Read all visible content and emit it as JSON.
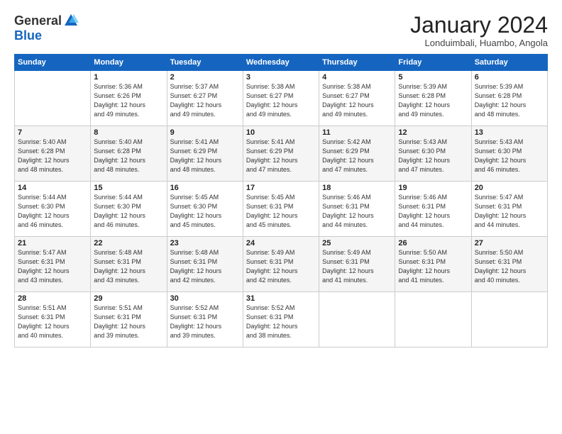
{
  "logo": {
    "general": "General",
    "blue": "Blue"
  },
  "title": "January 2024",
  "location": "Londuimbali, Huambo, Angola",
  "days_of_week": [
    "Sunday",
    "Monday",
    "Tuesday",
    "Wednesday",
    "Thursday",
    "Friday",
    "Saturday"
  ],
  "weeks": [
    [
      {
        "day": "",
        "info": ""
      },
      {
        "day": "1",
        "info": "Sunrise: 5:36 AM\nSunset: 6:26 PM\nDaylight: 12 hours\nand 49 minutes."
      },
      {
        "day": "2",
        "info": "Sunrise: 5:37 AM\nSunset: 6:27 PM\nDaylight: 12 hours\nand 49 minutes."
      },
      {
        "day": "3",
        "info": "Sunrise: 5:38 AM\nSunset: 6:27 PM\nDaylight: 12 hours\nand 49 minutes."
      },
      {
        "day": "4",
        "info": "Sunrise: 5:38 AM\nSunset: 6:27 PM\nDaylight: 12 hours\nand 49 minutes."
      },
      {
        "day": "5",
        "info": "Sunrise: 5:39 AM\nSunset: 6:28 PM\nDaylight: 12 hours\nand 49 minutes."
      },
      {
        "day": "6",
        "info": "Sunrise: 5:39 AM\nSunset: 6:28 PM\nDaylight: 12 hours\nand 48 minutes."
      }
    ],
    [
      {
        "day": "7",
        "info": "Sunrise: 5:40 AM\nSunset: 6:28 PM\nDaylight: 12 hours\nand 48 minutes."
      },
      {
        "day": "8",
        "info": "Sunrise: 5:40 AM\nSunset: 6:28 PM\nDaylight: 12 hours\nand 48 minutes."
      },
      {
        "day": "9",
        "info": "Sunrise: 5:41 AM\nSunset: 6:29 PM\nDaylight: 12 hours\nand 48 minutes."
      },
      {
        "day": "10",
        "info": "Sunrise: 5:41 AM\nSunset: 6:29 PM\nDaylight: 12 hours\nand 47 minutes."
      },
      {
        "day": "11",
        "info": "Sunrise: 5:42 AM\nSunset: 6:29 PM\nDaylight: 12 hours\nand 47 minutes."
      },
      {
        "day": "12",
        "info": "Sunrise: 5:43 AM\nSunset: 6:30 PM\nDaylight: 12 hours\nand 47 minutes."
      },
      {
        "day": "13",
        "info": "Sunrise: 5:43 AM\nSunset: 6:30 PM\nDaylight: 12 hours\nand 46 minutes."
      }
    ],
    [
      {
        "day": "14",
        "info": "Sunrise: 5:44 AM\nSunset: 6:30 PM\nDaylight: 12 hours\nand 46 minutes."
      },
      {
        "day": "15",
        "info": "Sunrise: 5:44 AM\nSunset: 6:30 PM\nDaylight: 12 hours\nand 46 minutes."
      },
      {
        "day": "16",
        "info": "Sunrise: 5:45 AM\nSunset: 6:30 PM\nDaylight: 12 hours\nand 45 minutes."
      },
      {
        "day": "17",
        "info": "Sunrise: 5:45 AM\nSunset: 6:31 PM\nDaylight: 12 hours\nand 45 minutes."
      },
      {
        "day": "18",
        "info": "Sunrise: 5:46 AM\nSunset: 6:31 PM\nDaylight: 12 hours\nand 44 minutes."
      },
      {
        "day": "19",
        "info": "Sunrise: 5:46 AM\nSunset: 6:31 PM\nDaylight: 12 hours\nand 44 minutes."
      },
      {
        "day": "20",
        "info": "Sunrise: 5:47 AM\nSunset: 6:31 PM\nDaylight: 12 hours\nand 44 minutes."
      }
    ],
    [
      {
        "day": "21",
        "info": "Sunrise: 5:47 AM\nSunset: 6:31 PM\nDaylight: 12 hours\nand 43 minutes."
      },
      {
        "day": "22",
        "info": "Sunrise: 5:48 AM\nSunset: 6:31 PM\nDaylight: 12 hours\nand 43 minutes."
      },
      {
        "day": "23",
        "info": "Sunrise: 5:48 AM\nSunset: 6:31 PM\nDaylight: 12 hours\nand 42 minutes."
      },
      {
        "day": "24",
        "info": "Sunrise: 5:49 AM\nSunset: 6:31 PM\nDaylight: 12 hours\nand 42 minutes."
      },
      {
        "day": "25",
        "info": "Sunrise: 5:49 AM\nSunset: 6:31 PM\nDaylight: 12 hours\nand 41 minutes."
      },
      {
        "day": "26",
        "info": "Sunrise: 5:50 AM\nSunset: 6:31 PM\nDaylight: 12 hours\nand 41 minutes."
      },
      {
        "day": "27",
        "info": "Sunrise: 5:50 AM\nSunset: 6:31 PM\nDaylight: 12 hours\nand 40 minutes."
      }
    ],
    [
      {
        "day": "28",
        "info": "Sunrise: 5:51 AM\nSunset: 6:31 PM\nDaylight: 12 hours\nand 40 minutes."
      },
      {
        "day": "29",
        "info": "Sunrise: 5:51 AM\nSunset: 6:31 PM\nDaylight: 12 hours\nand 39 minutes."
      },
      {
        "day": "30",
        "info": "Sunrise: 5:52 AM\nSunset: 6:31 PM\nDaylight: 12 hours\nand 39 minutes."
      },
      {
        "day": "31",
        "info": "Sunrise: 5:52 AM\nSunset: 6:31 PM\nDaylight: 12 hours\nand 38 minutes."
      },
      {
        "day": "",
        "info": ""
      },
      {
        "day": "",
        "info": ""
      },
      {
        "day": "",
        "info": ""
      }
    ]
  ]
}
